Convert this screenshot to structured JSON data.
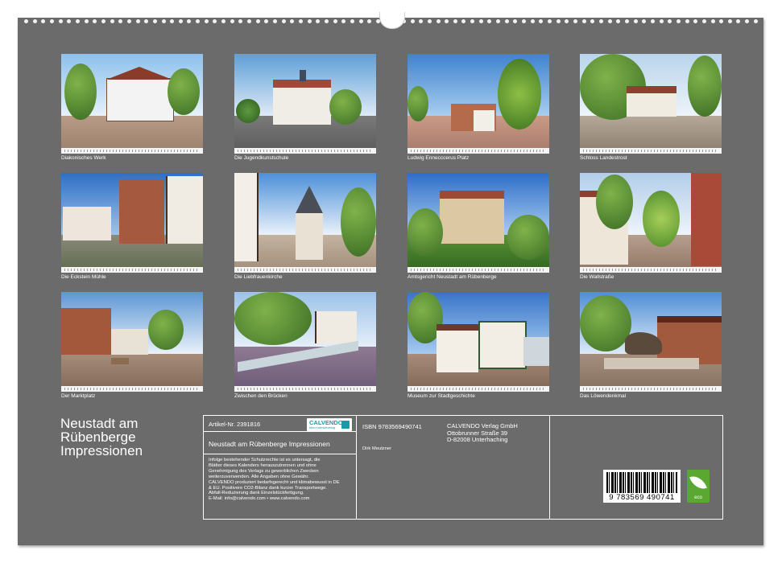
{
  "photos": [
    {
      "caption": "Diakonisches Werk"
    },
    {
      "caption": "Die Jugendkunstschule"
    },
    {
      "caption": "Ludwig Ennecccerus Platz"
    },
    {
      "caption": "Schloss Landestrost"
    },
    {
      "caption": "Die Eckstein Mühle"
    },
    {
      "caption": "Die Liebfrauenkirche"
    },
    {
      "caption": "Amtsgericht Neustadt am Rübenberge"
    },
    {
      "caption": "Die Wallstraße"
    },
    {
      "caption": "Der Marktplatz"
    },
    {
      "caption": "Zwischen den Brücken"
    },
    {
      "caption": "Museum zur Stadtgeschichte"
    },
    {
      "caption": "Das Löwendenkmal"
    }
  ],
  "cover_title": [
    "Neustadt am",
    "Rübenberge",
    "Impressionen"
  ],
  "info": {
    "article": "Artikel-Nr. 2391816",
    "logo_text": "CALVENDO",
    "logo_sub": "Mein Kalenderverlag",
    "product_title": "Neustadt am Rübenberge Impressionen",
    "legal": [
      "Infolge bestehender Schutzrechte ist es untersagt, die",
      "Blätter dieses Kalenders herauszutrennen und ohne",
      "Genehmigung des Verlags zu gewerblichen Zwecken",
      "weiterzuverwenden. Alle Angaben ohne Gewähr.",
      "CALVENDO produziert bedarfsgerecht und klimabewusst in DE",
      "& EU. Positivere CO2-Bilanz dank kurzer Transportwege.",
      "Abfall-Reduzierung dank Einzelstückfertigung.",
      "E-Mail: info@calvendo.com • www.calvendo.com"
    ],
    "isbn": "ISBN 9783569490741",
    "author": "Dirk Meutzner",
    "publisher": [
      "CALVENDO Verlag GmbH",
      "Ottobrunner Straße 39",
      "D-82008 Unterhaching"
    ],
    "barcode_number": "9 783569 490741",
    "eco_label": "eco"
  }
}
